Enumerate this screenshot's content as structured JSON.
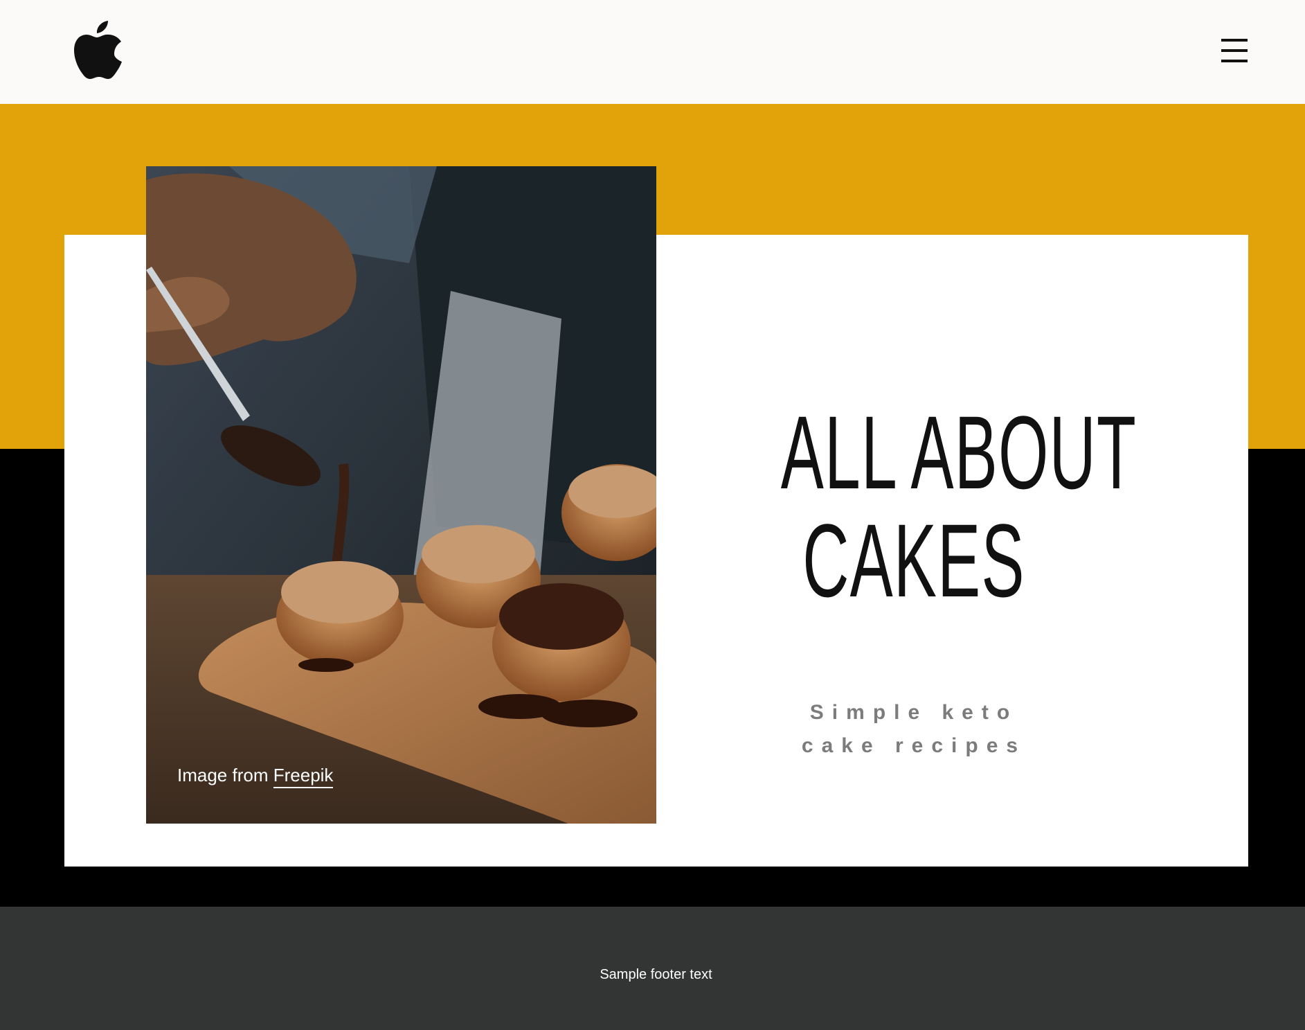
{
  "header": {
    "logo_icon": "apple-logo-icon",
    "menu_icon": "hamburger-menu-icon"
  },
  "hero": {
    "title_line1": "ALL ABOUT",
    "title_line2": "CAKES",
    "subtitle_line1": "Simple keto",
    "subtitle_line2": "cake recipes",
    "image_credit_prefix": "Image from",
    "image_credit_link": "Freepik"
  },
  "footer": {
    "text": "Sample footer text"
  },
  "colors": {
    "header_bg": "#fbfaf8",
    "accent_gold": "#e2a30a",
    "band_black": "#000000",
    "footer_bg": "#333534",
    "subtitle_gray": "#7c7c7c"
  }
}
